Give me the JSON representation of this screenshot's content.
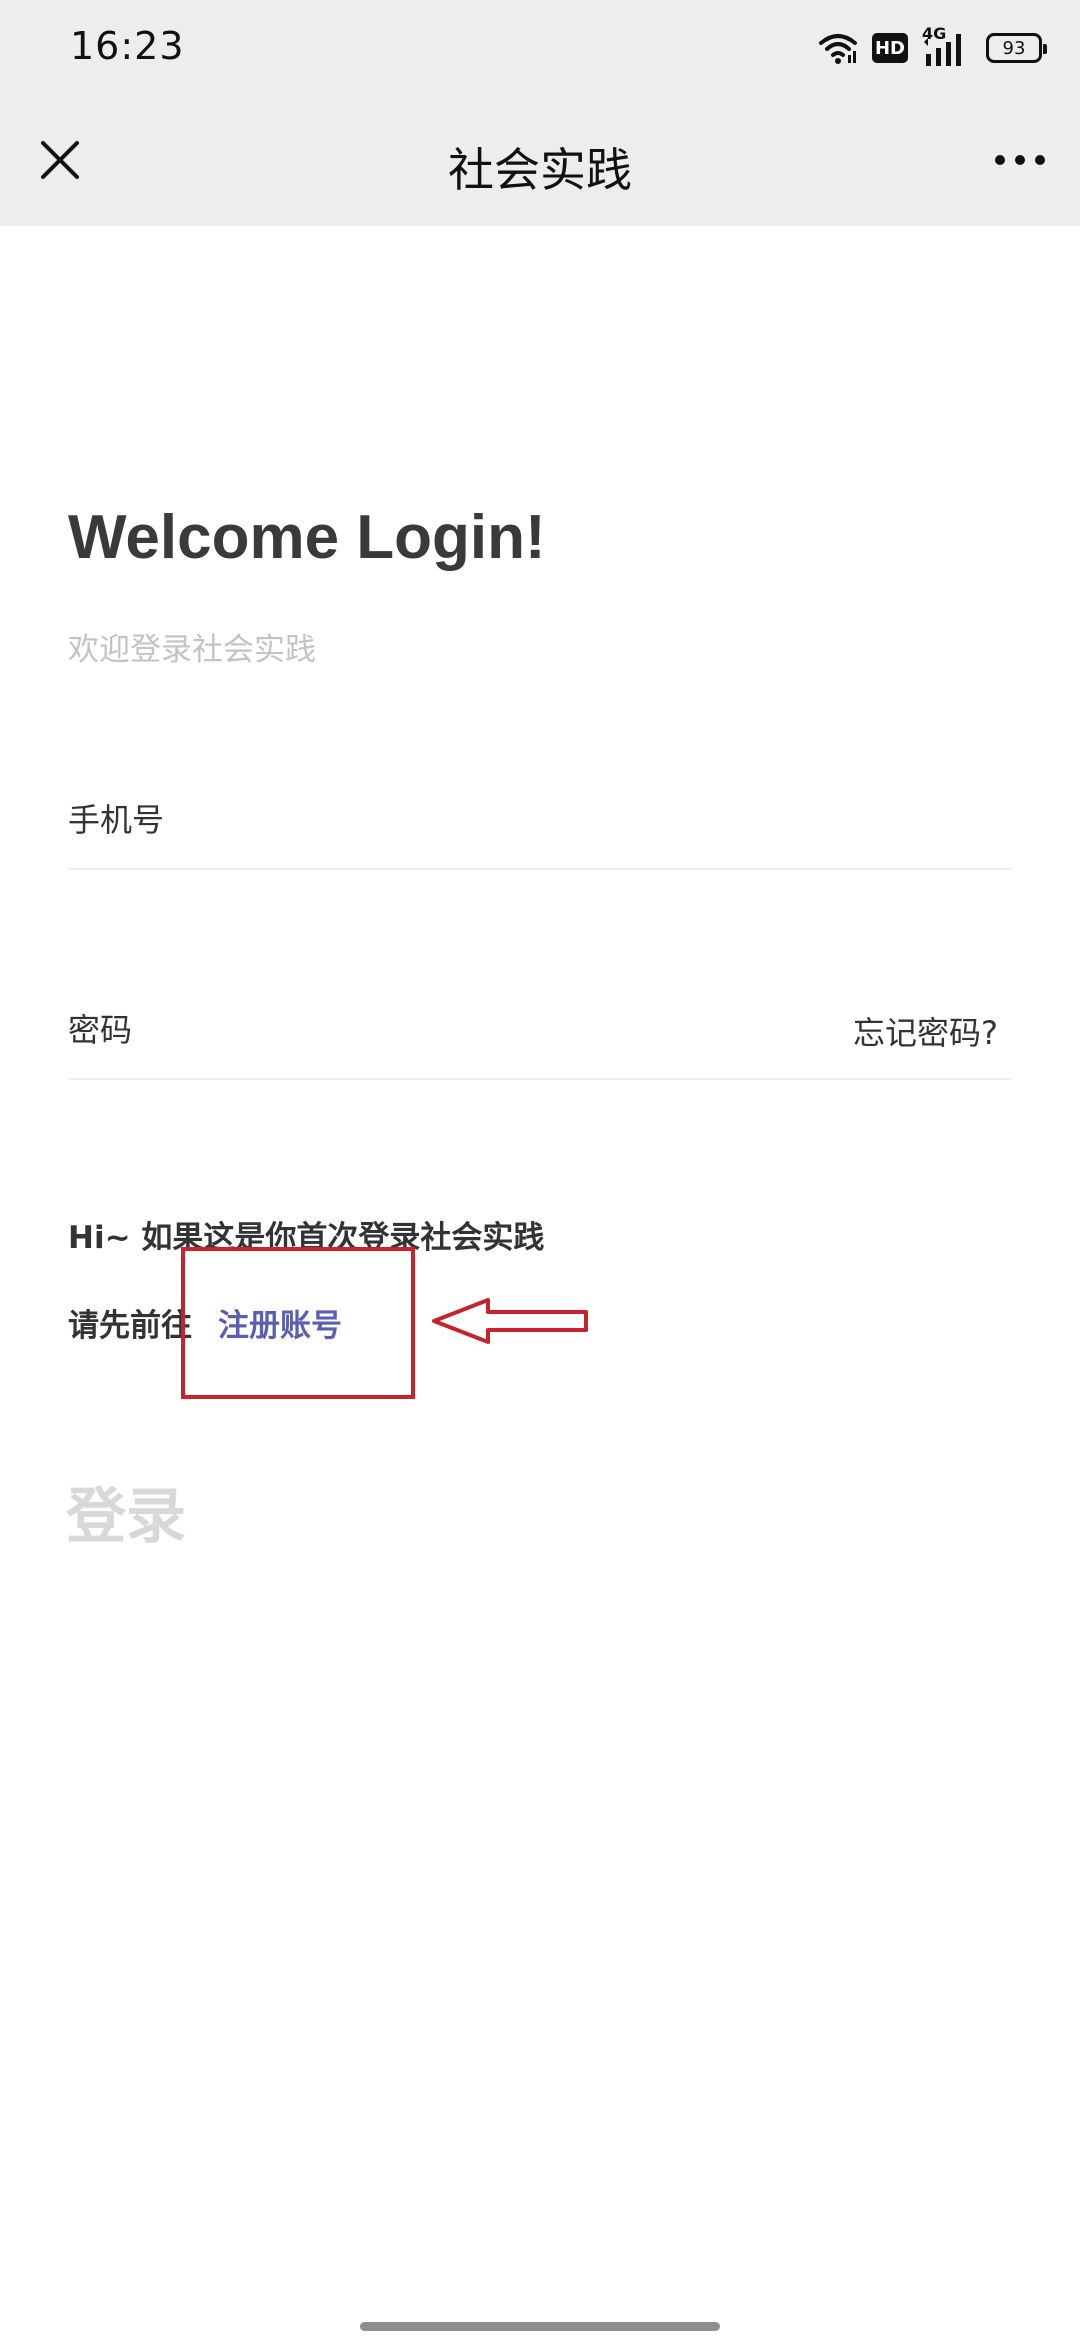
{
  "status_bar": {
    "time": "16:23",
    "hd_label": "HD",
    "network_label": "4G",
    "battery_level": "93"
  },
  "nav": {
    "title": "社会实践",
    "close_icon": "close-icon",
    "more_icon": "more-icon"
  },
  "login": {
    "title": "Welcome Login!",
    "subtitle": "欢迎登录社会实践",
    "phone_placeholder": "手机号",
    "password_placeholder": "密码",
    "forgot_password": "忘记密码?",
    "hint_line1": "Hi~ 如果这是你首次登录社会实践",
    "hint_line2_prefix": "请先前往",
    "register_link": "注册账号",
    "submit_label": "登录"
  },
  "colors": {
    "header_bg": "#ededed",
    "title_text": "#3a3a3a",
    "subtitle_text": "#c3c3c3",
    "link_color": "#5a5fb0",
    "disabled_button": "#d8d8d8",
    "annotation": "#c8232c"
  }
}
